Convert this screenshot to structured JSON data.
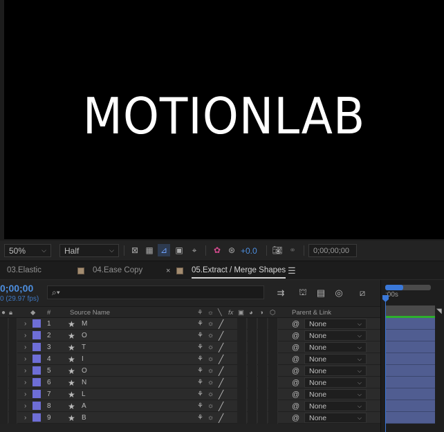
{
  "viewer": {
    "title": "MOTIONLAB"
  },
  "viewer_bar": {
    "zoom": "50%",
    "resolution": "Half",
    "exposure": "+0.0",
    "timecode": "0;00;00;00"
  },
  "tabs": [
    {
      "label": "03.Elastic"
    },
    {
      "label": "04.Ease Copy"
    },
    {
      "label": "05.Extract / Merge Shapes"
    }
  ],
  "timeline": {
    "current_time": "0;00;00",
    "fps": "0 (29.97 fps)",
    "search_placeholder": "",
    "ruler_tick": ":00s"
  },
  "columns": {
    "number": "#",
    "source_name": "Source Name",
    "parent_link": "Parent & Link"
  },
  "layers": [
    {
      "num": "1",
      "name": "M",
      "parent": "None"
    },
    {
      "num": "2",
      "name": "O",
      "parent": "None"
    },
    {
      "num": "3",
      "name": "T",
      "parent": "None"
    },
    {
      "num": "4",
      "name": "I",
      "parent": "None"
    },
    {
      "num": "5",
      "name": "O",
      "parent": "None"
    },
    {
      "num": "6",
      "name": "N",
      "parent": "None"
    },
    {
      "num": "7",
      "name": "L",
      "parent": "None"
    },
    {
      "num": "8",
      "name": "A",
      "parent": "None"
    },
    {
      "num": "9",
      "name": "B",
      "parent": "None"
    }
  ],
  "colors": {
    "accent": "#3a78d8",
    "label_purple": "#6e6ed6",
    "layer_bar": "#505d91",
    "tab_swatch": "#a38c70"
  }
}
